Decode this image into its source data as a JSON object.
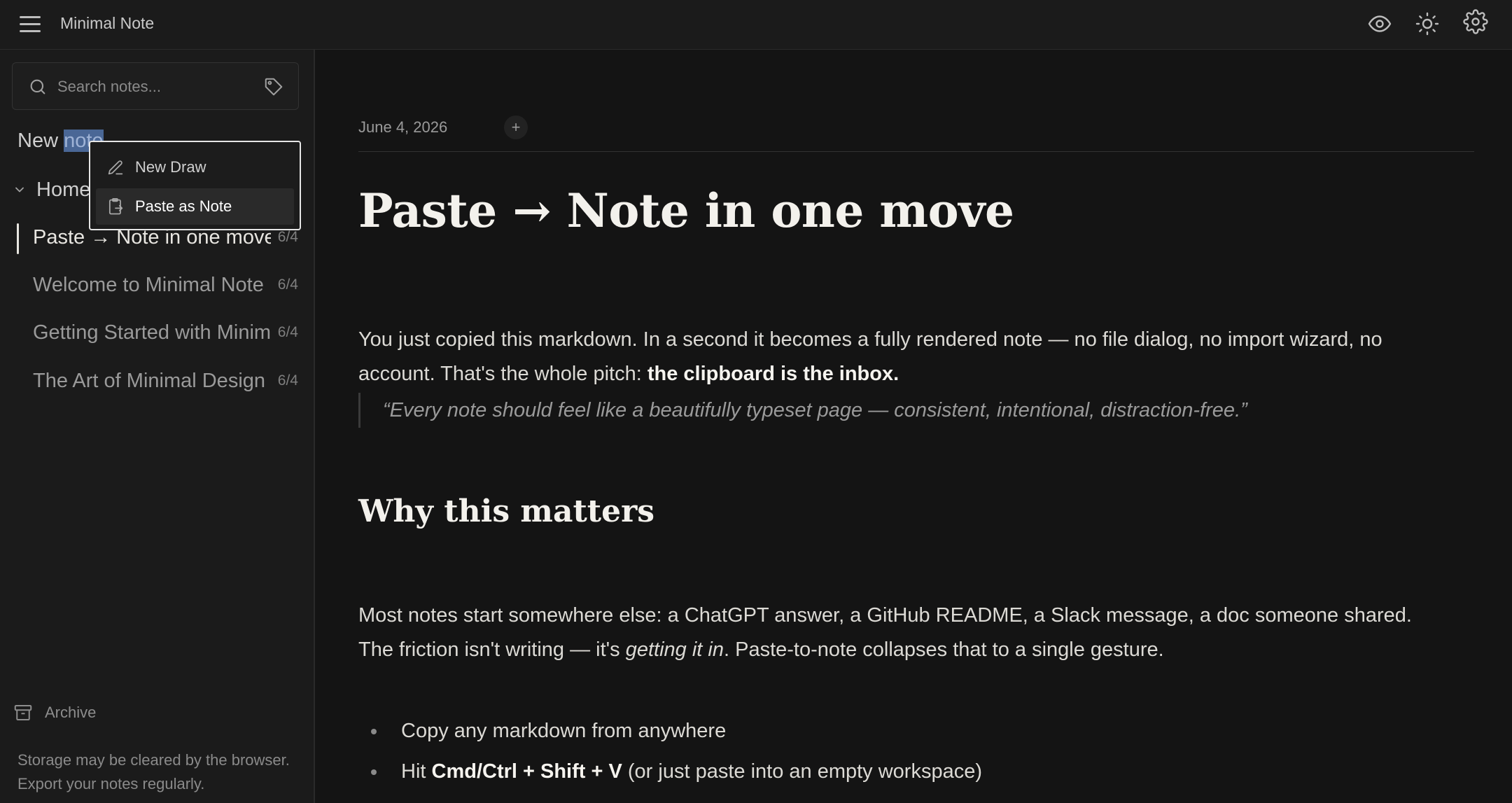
{
  "app": {
    "title": "Minimal Note"
  },
  "search": {
    "placeholder": "Search notes..."
  },
  "sidebar": {
    "new_note_prefix": "New ",
    "new_note_selected": "note",
    "group_label": "Home",
    "notes": [
      {
        "title": "Paste → Note in one move",
        "date": "6/4",
        "active": true
      },
      {
        "title": "Welcome to Minimal Note",
        "date": "6/4"
      },
      {
        "title": "Getting Started with Minimal Note",
        "date": "6/4"
      },
      {
        "title": "The Art of Minimal Design",
        "date": "6/4"
      }
    ],
    "archive_label": "Archive",
    "storage_note": "Storage may be cleared by the browser. Export your notes regularly."
  },
  "context_menu": {
    "items": [
      {
        "label": "New Draw",
        "icon": "pencil-icon"
      },
      {
        "label": "Paste as Note",
        "icon": "clipboard-icon"
      }
    ]
  },
  "document": {
    "date": "June 4, 2026",
    "add_tag": "+",
    "title": "Paste → Note in one move",
    "para1_line1": "You just copied this markdown. In a second it becomes a fully rendered note — no file dialog, no import wizard, no",
    "para1_line2_start": "account. That's the whole pitch: ",
    "para1_line2_bold": "the clipboard is the inbox.",
    "quote": "“Every note should feel like a beautifully typeset page — consistent, intentional, distraction-free.”",
    "heading2": "Why this matters",
    "para2_line1": "Most notes start somewhere else: a ChatGPT answer, a GitHub README, a Slack message, a doc someone shared.",
    "para2_line2_start": "The friction isn't writing — it's ",
    "para2_line2_italic": "getting it in",
    "para2_line2_end": ". Paste-to-note collapses that to a single gesture.",
    "bullet1": "Copy any markdown from anywhere",
    "bullet2_start": "Hit ",
    "bullet2_bold": "Cmd/Ctrl + Shift + V",
    "bullet2_end": " (or just paste into an empty workspace)"
  },
  "icons": {
    "top_right": [
      "eye-icon",
      "sun-icon",
      "gear-icon"
    ]
  },
  "colors": {
    "background": "#141414",
    "sidebar": "#1b1b1b",
    "selection": "#4a6796",
    "text": "#e8e6e1"
  }
}
